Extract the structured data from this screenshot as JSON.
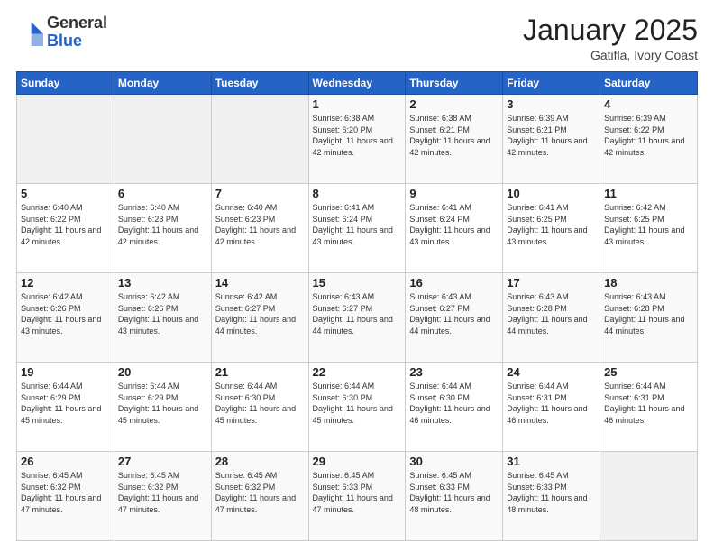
{
  "header": {
    "logo": {
      "general": "General",
      "blue": "Blue"
    },
    "title": "January 2025",
    "subtitle": "Gatifla, Ivory Coast"
  },
  "days_of_week": [
    "Sunday",
    "Monday",
    "Tuesday",
    "Wednesday",
    "Thursday",
    "Friday",
    "Saturday"
  ],
  "weeks": [
    [
      {
        "day": "",
        "info": ""
      },
      {
        "day": "",
        "info": ""
      },
      {
        "day": "",
        "info": ""
      },
      {
        "day": "1",
        "info": "Sunrise: 6:38 AM\nSunset: 6:20 PM\nDaylight: 11 hours\nand 42 minutes."
      },
      {
        "day": "2",
        "info": "Sunrise: 6:38 AM\nSunset: 6:21 PM\nDaylight: 11 hours\nand 42 minutes."
      },
      {
        "day": "3",
        "info": "Sunrise: 6:39 AM\nSunset: 6:21 PM\nDaylight: 11 hours\nand 42 minutes."
      },
      {
        "day": "4",
        "info": "Sunrise: 6:39 AM\nSunset: 6:22 PM\nDaylight: 11 hours\nand 42 minutes."
      }
    ],
    [
      {
        "day": "5",
        "info": "Sunrise: 6:40 AM\nSunset: 6:22 PM\nDaylight: 11 hours\nand 42 minutes."
      },
      {
        "day": "6",
        "info": "Sunrise: 6:40 AM\nSunset: 6:23 PM\nDaylight: 11 hours\nand 42 minutes."
      },
      {
        "day": "7",
        "info": "Sunrise: 6:40 AM\nSunset: 6:23 PM\nDaylight: 11 hours\nand 42 minutes."
      },
      {
        "day": "8",
        "info": "Sunrise: 6:41 AM\nSunset: 6:24 PM\nDaylight: 11 hours\nand 43 minutes."
      },
      {
        "day": "9",
        "info": "Sunrise: 6:41 AM\nSunset: 6:24 PM\nDaylight: 11 hours\nand 43 minutes."
      },
      {
        "day": "10",
        "info": "Sunrise: 6:41 AM\nSunset: 6:25 PM\nDaylight: 11 hours\nand 43 minutes."
      },
      {
        "day": "11",
        "info": "Sunrise: 6:42 AM\nSunset: 6:25 PM\nDaylight: 11 hours\nand 43 minutes."
      }
    ],
    [
      {
        "day": "12",
        "info": "Sunrise: 6:42 AM\nSunset: 6:26 PM\nDaylight: 11 hours\nand 43 minutes."
      },
      {
        "day": "13",
        "info": "Sunrise: 6:42 AM\nSunset: 6:26 PM\nDaylight: 11 hours\nand 43 minutes."
      },
      {
        "day": "14",
        "info": "Sunrise: 6:42 AM\nSunset: 6:27 PM\nDaylight: 11 hours\nand 44 minutes."
      },
      {
        "day": "15",
        "info": "Sunrise: 6:43 AM\nSunset: 6:27 PM\nDaylight: 11 hours\nand 44 minutes."
      },
      {
        "day": "16",
        "info": "Sunrise: 6:43 AM\nSunset: 6:27 PM\nDaylight: 11 hours\nand 44 minutes."
      },
      {
        "day": "17",
        "info": "Sunrise: 6:43 AM\nSunset: 6:28 PM\nDaylight: 11 hours\nand 44 minutes."
      },
      {
        "day": "18",
        "info": "Sunrise: 6:43 AM\nSunset: 6:28 PM\nDaylight: 11 hours\nand 44 minutes."
      }
    ],
    [
      {
        "day": "19",
        "info": "Sunrise: 6:44 AM\nSunset: 6:29 PM\nDaylight: 11 hours\nand 45 minutes."
      },
      {
        "day": "20",
        "info": "Sunrise: 6:44 AM\nSunset: 6:29 PM\nDaylight: 11 hours\nand 45 minutes."
      },
      {
        "day": "21",
        "info": "Sunrise: 6:44 AM\nSunset: 6:30 PM\nDaylight: 11 hours\nand 45 minutes."
      },
      {
        "day": "22",
        "info": "Sunrise: 6:44 AM\nSunset: 6:30 PM\nDaylight: 11 hours\nand 45 minutes."
      },
      {
        "day": "23",
        "info": "Sunrise: 6:44 AM\nSunset: 6:30 PM\nDaylight: 11 hours\nand 46 minutes."
      },
      {
        "day": "24",
        "info": "Sunrise: 6:44 AM\nSunset: 6:31 PM\nDaylight: 11 hours\nand 46 minutes."
      },
      {
        "day": "25",
        "info": "Sunrise: 6:44 AM\nSunset: 6:31 PM\nDaylight: 11 hours\nand 46 minutes."
      }
    ],
    [
      {
        "day": "26",
        "info": "Sunrise: 6:45 AM\nSunset: 6:32 PM\nDaylight: 11 hours\nand 47 minutes."
      },
      {
        "day": "27",
        "info": "Sunrise: 6:45 AM\nSunset: 6:32 PM\nDaylight: 11 hours\nand 47 minutes."
      },
      {
        "day": "28",
        "info": "Sunrise: 6:45 AM\nSunset: 6:32 PM\nDaylight: 11 hours\nand 47 minutes."
      },
      {
        "day": "29",
        "info": "Sunrise: 6:45 AM\nSunset: 6:33 PM\nDaylight: 11 hours\nand 47 minutes."
      },
      {
        "day": "30",
        "info": "Sunrise: 6:45 AM\nSunset: 6:33 PM\nDaylight: 11 hours\nand 48 minutes."
      },
      {
        "day": "31",
        "info": "Sunrise: 6:45 AM\nSunset: 6:33 PM\nDaylight: 11 hours\nand 48 minutes."
      },
      {
        "day": "",
        "info": ""
      }
    ]
  ]
}
